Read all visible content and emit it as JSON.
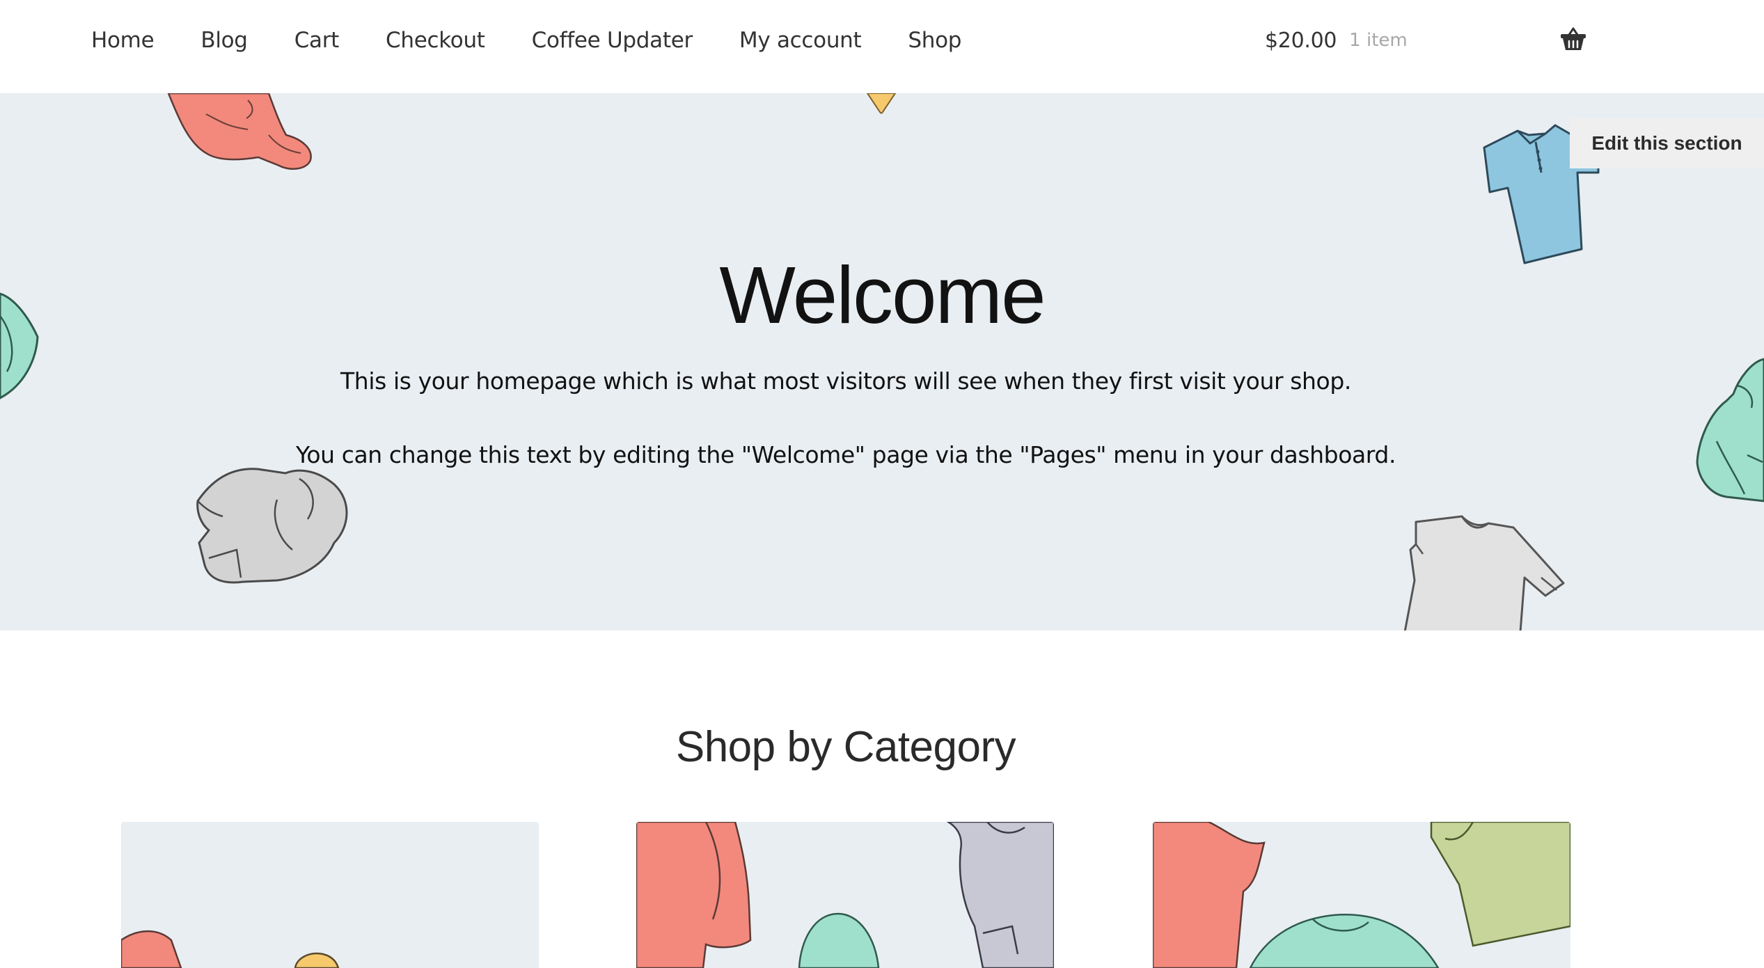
{
  "nav": {
    "items": [
      {
        "label": "Home"
      },
      {
        "label": "Blog"
      },
      {
        "label": "Cart"
      },
      {
        "label": "Checkout"
      },
      {
        "label": "Coffee Updater"
      },
      {
        "label": "My account"
      },
      {
        "label": "Shop"
      }
    ]
  },
  "cart": {
    "amount": "$20.00",
    "count": "1 item",
    "icon": "basket-icon"
  },
  "hero": {
    "title": "Welcome",
    "paragraph1": "This is your homepage which is what most visitors will see when they first visit your shop.",
    "paragraph2": "You can change this text by editing the \"Welcome\" page via the \"Pages\" menu in your dashboard.",
    "edit_label": "Edit this section",
    "background_color": "#e9eef2"
  },
  "categories": {
    "title": "Shop by Category"
  }
}
